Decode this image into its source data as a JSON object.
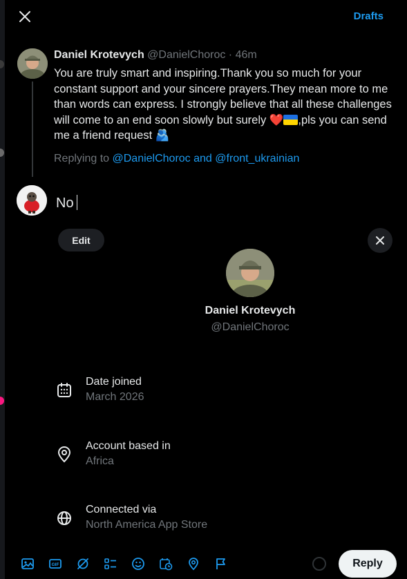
{
  "header": {
    "drafts_label": "Drafts"
  },
  "post": {
    "author_name": "Daniel Krotevych",
    "author_handle": "@DanielChoroc",
    "separator": " · ",
    "time": "46m",
    "text_1": "You are truly smart and inspiring.Thank you so much for your constant support and your sincere prayers.They mean more to me than words can express. I strongly believe that all these challenges will come to an end soon slowly but surely ",
    "emoji_heart": "❤️",
    "text_2": ",pls you can send me a friend request ",
    "emoji_hug": "🫂",
    "replying_prefix": "Replying to ",
    "replying_to_1": "@DanielChoroc",
    "replying_and": " and ",
    "replying_to_2": "@front_ukrainian"
  },
  "compose": {
    "text": "No"
  },
  "card": {
    "edit_label": "Edit",
    "name": "Daniel Krotevych",
    "handle": "@DanielChoroc",
    "rows": [
      {
        "icon": "calendar-icon",
        "title": "Date joined",
        "value": "March 2026"
      },
      {
        "icon": "location-pin-icon",
        "title": "Account based in",
        "value": "Africa"
      },
      {
        "icon": "globe-icon",
        "title": "Connected via",
        "value": "North America App Store"
      }
    ]
  },
  "toolbar": {
    "icons": [
      "image-icon",
      "gif-icon",
      "grok-icon",
      "poll-icon",
      "emoji-icon",
      "schedule-icon",
      "location-icon",
      "flag-icon"
    ],
    "reply_label": "Reply"
  },
  "colors": {
    "accent": "#1d9bf0",
    "background": "#000000",
    "muted": "#71767b"
  }
}
